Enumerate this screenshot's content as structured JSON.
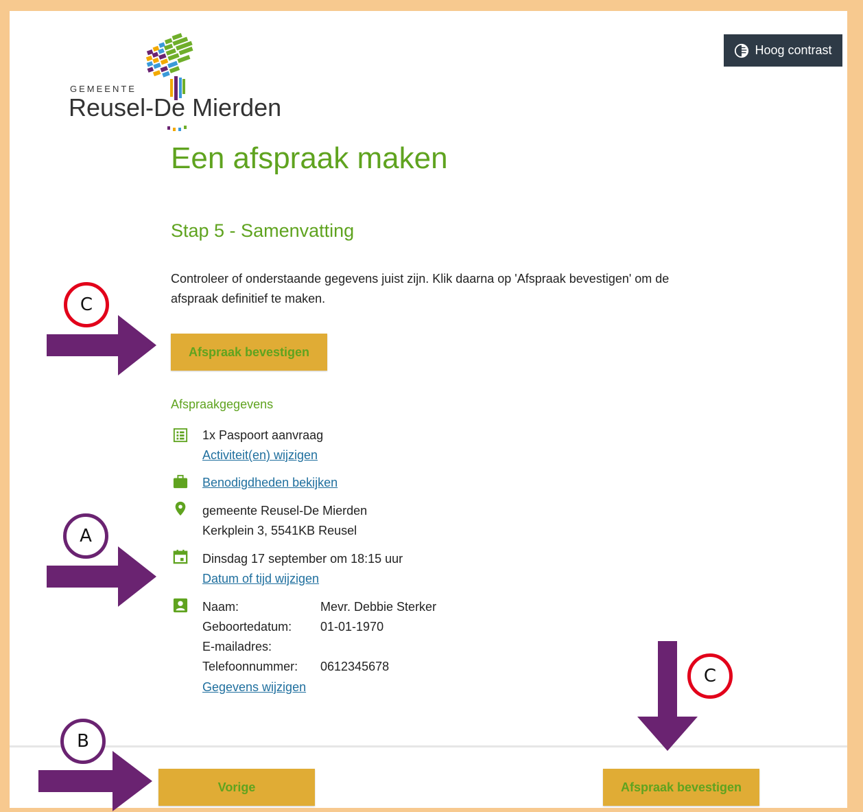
{
  "header": {
    "logo_small": "GEMEENTE",
    "logo_name": "Reusel-De Mierden",
    "contrast_label": "Hoog contrast"
  },
  "page": {
    "title": "Een afspraak maken",
    "step": "Stap 5 - Samenvatting",
    "intro": "Controleer of onderstaande gegevens juist zijn. Klik daarna op 'Afspraak bevestigen' om de afspraak definitief te maken.",
    "confirm_label": "Afspraak bevestigen"
  },
  "summary": {
    "section_title": "Afspraakgegevens",
    "activity": "1x Paspoort aanvraag",
    "activity_link": "Activiteit(en) wijzigen",
    "requirements_link": "Benodigdheden bekijken",
    "location_name": "gemeente Reusel-De Mierden",
    "location_address": "Kerkplein 3, 5541KB Reusel",
    "datetime": "Dinsdag 17 september om 18:15 uur",
    "datetime_link": "Datum of tijd wijzigen",
    "person": {
      "name_label": "Naam:",
      "name_value": "Mevr. Debbie Sterker",
      "dob_label": "Geboortedatum:",
      "dob_value": "01-01-1970",
      "email_label": "E-mailadres:",
      "email_value": "",
      "phone_label": "Telefoonnummer:",
      "phone_value": "0612345678"
    },
    "person_link": "Gegevens wijzigen"
  },
  "footer": {
    "prev_label": "Vorige",
    "confirm_label": "Afspraak bevestigen"
  },
  "annotations": {
    "marker_c": "C",
    "marker_a": "A",
    "marker_b": "B"
  },
  "colors": {
    "brand_green": "#5fa31f",
    "button_yellow": "#e0ac35",
    "link_blue": "#1f6f9e",
    "arrow_purple": "#6a2371",
    "marker_red": "#e2001a",
    "frame_orange": "#f7c98f"
  },
  "icons": {
    "contrast": "contrast-icon",
    "list": "list-icon",
    "briefcase": "briefcase-icon",
    "location": "location-pin-icon",
    "calendar": "calendar-icon",
    "person": "person-badge-icon",
    "arrow": "arrow-icon"
  }
}
